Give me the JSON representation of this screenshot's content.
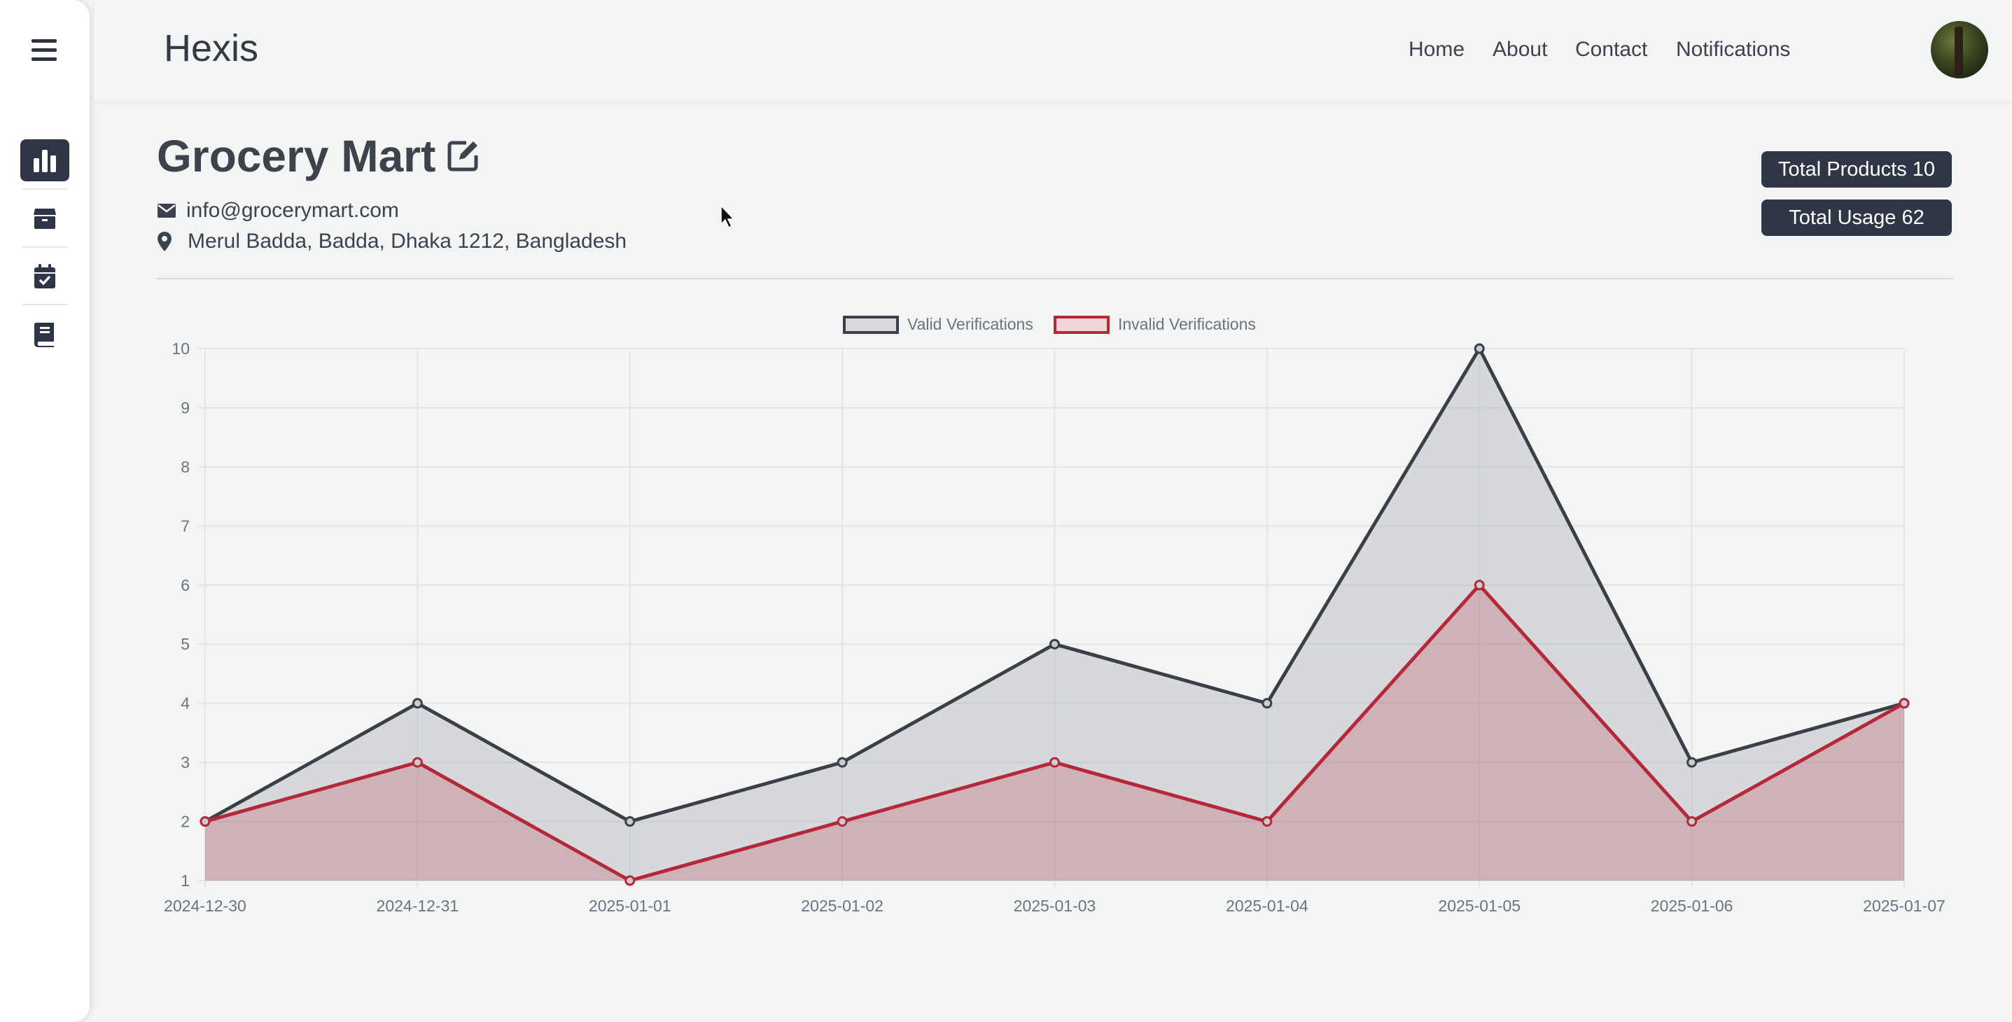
{
  "app": {
    "brand": "Hexis"
  },
  "nav": {
    "links": [
      "Home",
      "About",
      "Contact",
      "Notifications"
    ]
  },
  "sidebar": {
    "items": [
      "analytics",
      "products",
      "calendar",
      "book"
    ]
  },
  "store": {
    "name": "Grocery Mart",
    "email": "info@grocerymart.com",
    "address": "Merul Badda, Badda, Dhaka 1212, Bangladesh"
  },
  "stats": {
    "total_products_label": "Total Products",
    "total_products_value": "10",
    "total_usage_label": "Total Usage",
    "total_usage_value": "62"
  },
  "colors": {
    "valid_line": "#3b3f47",
    "valid_fill": "rgba(170,175,185,0.40)",
    "invalid_line": "#b5283a",
    "invalid_fill": "rgba(181,40,58,0.22)",
    "accent_dark": "#2f3746"
  },
  "chart_data": {
    "type": "line",
    "categories": [
      "2024-12-30",
      "2024-12-31",
      "2025-01-01",
      "2025-01-02",
      "2025-01-03",
      "2025-01-04",
      "2025-01-05",
      "2025-01-06",
      "2025-01-07"
    ],
    "series": [
      {
        "name": "Valid Verifications",
        "values": [
          2,
          4,
          2,
          3,
          5,
          4,
          10,
          3,
          4
        ]
      },
      {
        "name": "Invalid Verifications",
        "values": [
          2,
          3,
          1,
          2,
          3,
          2,
          6,
          2,
          4
        ]
      }
    ],
    "ylim": [
      1,
      10
    ],
    "yticks": [
      1,
      2,
      3,
      4,
      5,
      6,
      7,
      8,
      9,
      10
    ],
    "grid": true,
    "legend": "top-center",
    "fill": true
  }
}
